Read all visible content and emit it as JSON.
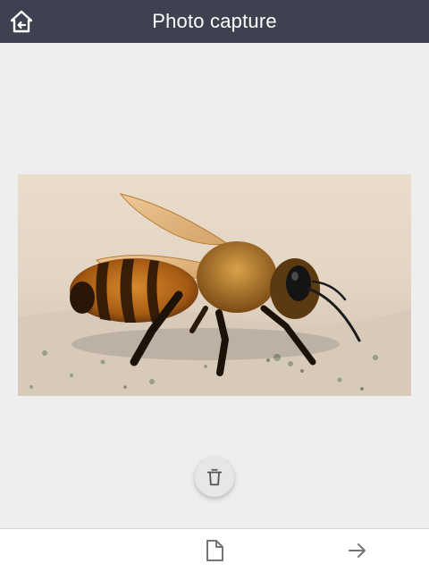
{
  "header": {
    "title": "Photo capture",
    "home_icon": "home-back-icon"
  },
  "photo": {
    "subject": "bee-photo"
  },
  "actions": {
    "delete_icon": "trash-icon"
  },
  "footer": {
    "document_icon": "document-icon",
    "next_icon": "arrow-right-icon"
  },
  "colors": {
    "topbar": "#3e4150",
    "background": "#eeeeee",
    "footer": "#ffffff",
    "icon_gray": "#757575"
  }
}
